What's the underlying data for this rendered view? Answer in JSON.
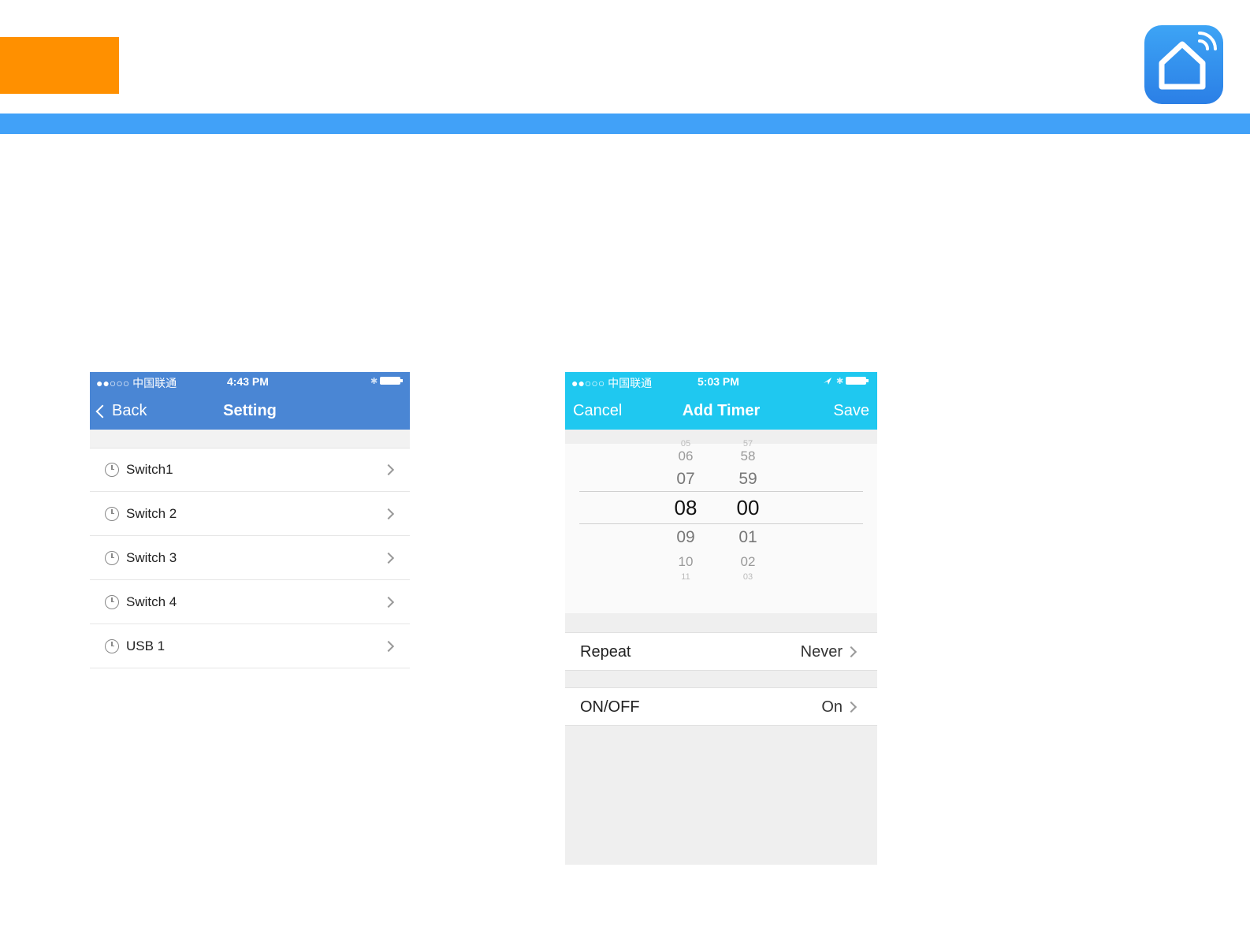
{
  "colors": {
    "orange": "#ff9000",
    "band": "#41a1f8",
    "setting_header": "#4a86d4",
    "timer_header": "#1fc8f0"
  },
  "logo": {
    "icon": "smart-home-house-wifi-icon"
  },
  "setting_screen": {
    "status": {
      "carrier": "●●○○○ 中国联通",
      "time": "4:43 PM"
    },
    "back_label": "Back",
    "title": "Setting",
    "items": [
      {
        "label": "Switch1"
      },
      {
        "label": "Switch 2"
      },
      {
        "label": "Switch 3"
      },
      {
        "label": "Switch 4"
      },
      {
        "label": "USB 1"
      }
    ]
  },
  "timer_screen": {
    "status": {
      "carrier": "●●○○○ 中国联通",
      "time": "5:03 PM"
    },
    "cancel_label": "Cancel",
    "title": "Add Timer",
    "save_label": "Save",
    "picker": {
      "hours": [
        "05",
        "06",
        "07",
        "08",
        "09",
        "10",
        "11"
      ],
      "minutes": [
        "57",
        "58",
        "59",
        "00",
        "01",
        "02",
        "03"
      ],
      "selected_hour": "08",
      "selected_minute": "00"
    },
    "repeat": {
      "label": "Repeat",
      "value": "Never"
    },
    "onoff": {
      "label": "ON/OFF",
      "value": "On"
    }
  }
}
